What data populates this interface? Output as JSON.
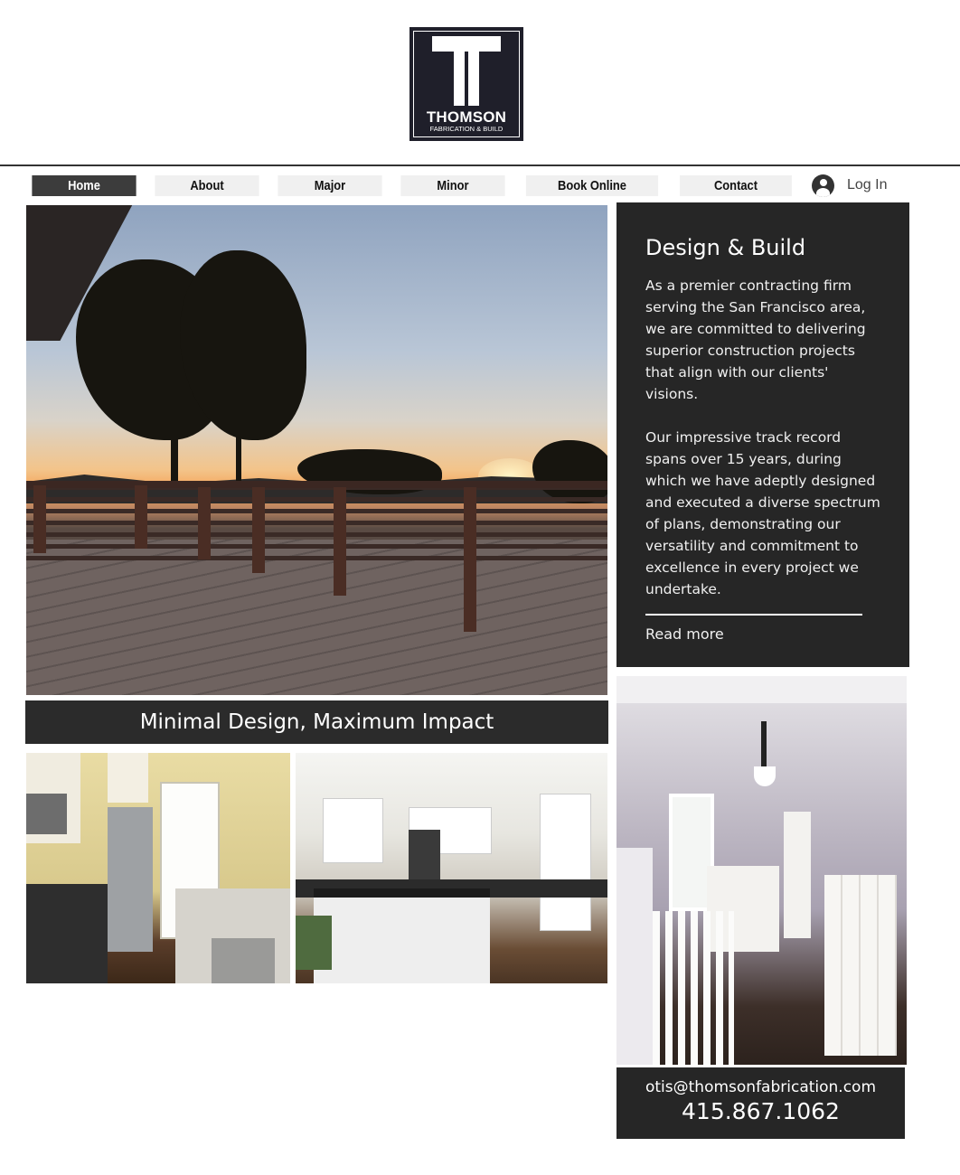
{
  "logo": {
    "name": "THOMSON",
    "subtitle": "FABRICATION & BUILD"
  },
  "nav": {
    "items": [
      {
        "label": "Home",
        "active": true
      },
      {
        "label": "About",
        "active": false
      },
      {
        "label": "Major",
        "active": false
      },
      {
        "label": "Minor",
        "active": false
      },
      {
        "label": "Book Online",
        "active": false
      },
      {
        "label": "Contact",
        "active": false
      }
    ],
    "login_label": "Log In",
    "login_icon": "user-avatar-icon"
  },
  "main": {
    "tagline": "Minimal Design, Maximum Impact"
  },
  "info": {
    "title": "Design & Build",
    "body": "As a premier contracting firm serving the San Francisco area, we are committed to delivering superior construction projects that align with our clients' visions.\n\nOur impressive track record spans over 15 years, during which we have adeptly designed and executed a diverse spectrum of plans, demonstrating our versatility and commitment to excellence in every project we undertake.",
    "read_more": "Read more"
  },
  "contact": {
    "email": "otis@thomsonfabrication.com",
    "phone": "415.867.1062"
  },
  "colors": {
    "panel": "#262626",
    "nav_active": "#3c3c3c",
    "nav_inactive": "#f0f0f0"
  }
}
